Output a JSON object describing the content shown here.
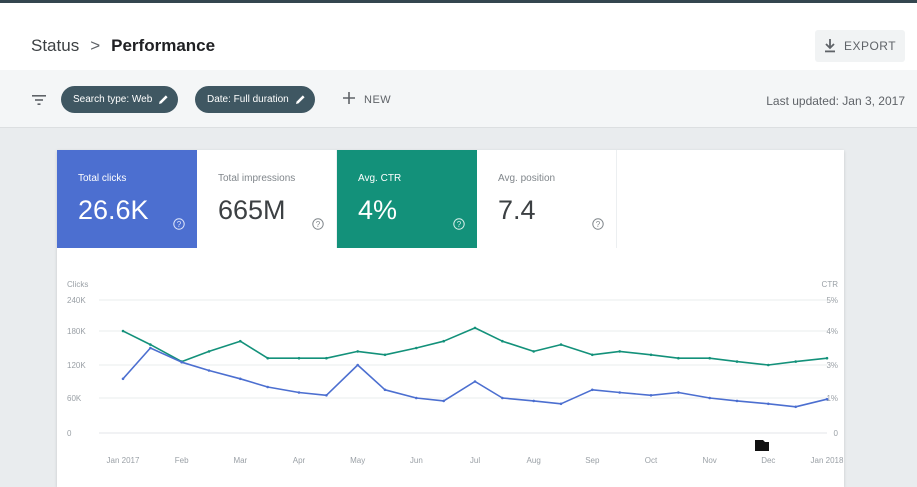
{
  "header": {
    "breadcrumb_root": "Status",
    "breadcrumb_separator": ">",
    "breadcrumb_current": "Performance",
    "export_label": "EXPORT",
    "export_icon": "download-icon"
  },
  "filters": {
    "filter_icon": "filter-list-icon",
    "chips": [
      {
        "label": "Search type: Web",
        "icon": "edit-icon"
      },
      {
        "label": "Date: Full duration",
        "icon": "edit-icon"
      }
    ],
    "new_label": "NEW",
    "last_updated": "Last updated: Jan 3, 2017"
  },
  "metrics": [
    {
      "label": "Total clicks",
      "value": "26.6K",
      "active": true,
      "color": "#4c6fd0"
    },
    {
      "label": "Total impressions",
      "value": "665M",
      "active": false
    },
    {
      "label": "Avg. CTR",
      "value": "4%",
      "active": true,
      "color": "#13917a"
    },
    {
      "label": "Avg. position",
      "value": "7.4",
      "active": false
    }
  ],
  "chart_data": {
    "type": "line",
    "left_axis_label": "Clicks",
    "right_axis_label": "CTR",
    "left_ticks": [
      "240K",
      "180K",
      "120K",
      "60K",
      "0"
    ],
    "left_tick_values": [
      240000,
      180000,
      120000,
      60000,
      0
    ],
    "right_ticks": [
      "5%",
      "4%",
      "3%",
      "1%",
      "0"
    ],
    "right_tick_values": [
      5,
      4,
      3,
      1,
      0
    ],
    "x_tick_labels": [
      "Jan 2017",
      "Feb",
      "Mar",
      "Apr",
      "May",
      "Jun",
      "Jul",
      "Aug",
      "Sep",
      "Oct",
      "Nov",
      "Dec",
      "Jan 2018"
    ],
    "grid": true,
    "series": [
      {
        "name": "Clicks",
        "axis": "left",
        "color": "#4c6fd0",
        "x": [
          "2017-01",
          "2017-01-15",
          "2017-02",
          "2017-02-15",
          "2017-03",
          "2017-03-15",
          "2017-04",
          "2017-04-15",
          "2017-05",
          "2017-05-15",
          "2017-06",
          "2017-06-15",
          "2017-07",
          "2017-07-15",
          "2017-08",
          "2017-08-15",
          "2017-09",
          "2017-09-15",
          "2017-10",
          "2017-10-15",
          "2017-11",
          "2017-11-15",
          "2017-12",
          "2017-12-15",
          "2018-01"
        ],
        "values": [
          95000,
          150000,
          125000,
          110000,
          95000,
          80000,
          70000,
          65000,
          120000,
          75000,
          60000,
          55000,
          90000,
          60000,
          55000,
          50000,
          75000,
          70000,
          65000,
          70000,
          60000,
          55000,
          50000,
          45000,
          58000
        ]
      },
      {
        "name": "CTR",
        "axis": "right",
        "color": "#13917a",
        "x": [
          "2017-01",
          "2017-01-15",
          "2017-02",
          "2017-02-15",
          "2017-03",
          "2017-03-15",
          "2017-04",
          "2017-04-15",
          "2017-05",
          "2017-05-15",
          "2017-06",
          "2017-06-15",
          "2017-07",
          "2017-07-15",
          "2017-08",
          "2017-08-15",
          "2017-09",
          "2017-09-15",
          "2017-10",
          "2017-10-15",
          "2017-11",
          "2017-11-15",
          "2017-12",
          "2017-12-15",
          "2018-01"
        ],
        "values": [
          4.0,
          3.6,
          3.1,
          3.4,
          3.7,
          3.2,
          3.2,
          3.2,
          3.4,
          3.3,
          3.5,
          3.7,
          4.1,
          3.7,
          3.4,
          3.6,
          3.3,
          3.4,
          3.3,
          3.2,
          3.2,
          3.1,
          3.0,
          3.1,
          3.2
        ]
      }
    ]
  }
}
